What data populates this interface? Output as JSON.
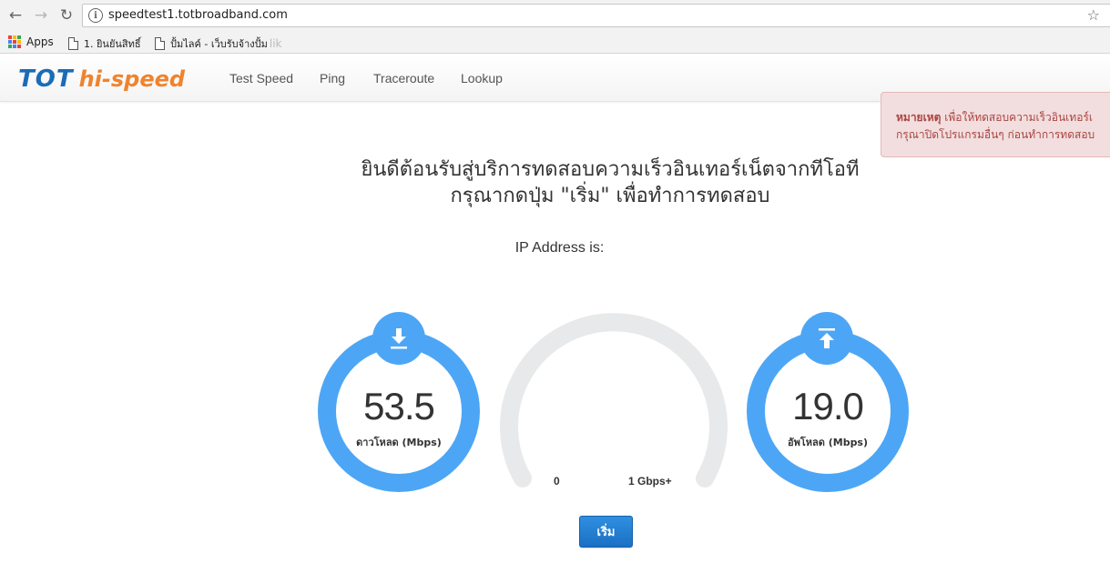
{
  "browser": {
    "url": "speedtest1.totbroadband.com",
    "bookmarks": [
      {
        "label": "Apps"
      },
      {
        "label": "1. ยินยันสิทธิ์"
      },
      {
        "label": "ปั้มไลค์ - เว็บรับจ้างปั้ม",
        "faded": "lik"
      }
    ]
  },
  "site": {
    "logo": {
      "tot": "TOT",
      "hispeed": "hi-speed"
    },
    "nav": [
      "Test Speed",
      "Ping",
      "Traceroute",
      "Lookup"
    ]
  },
  "alert": {
    "bold": "หมายเหตุ",
    "line1": "เพื่อให้ทดสอบความเร็วอินเทอร์เ",
    "line2": "กรุณาปิดโปรแกรมอื่นๆ ก่อนทำการทดสอบ"
  },
  "welcome": {
    "line1": "ยินดีต้อนรับสู่บริการทดสอบความเร็วอินเทอร์เน็ตจากทีโอที",
    "line2": "กรุณากดปุ่ม \"เริ่ม\" เพื่อทำการทดสอบ"
  },
  "ip_label": "IP Address is:",
  "download": {
    "value": "53.5",
    "unit": "ดาวโหลด (Mbps)"
  },
  "upload": {
    "value": "19.0",
    "unit": "อัพโหลด (Mbps)"
  },
  "speed_gauge": {
    "min_label": "0",
    "max_label": "1 Gbps+"
  },
  "start_button": "เริ่ม",
  "colors": {
    "accent": "#4da6f5",
    "brand_blue": "#1b6cb7",
    "brand_orange": "#f0832c",
    "alert_bg": "#f2dede",
    "alert_text": "#a94442"
  }
}
